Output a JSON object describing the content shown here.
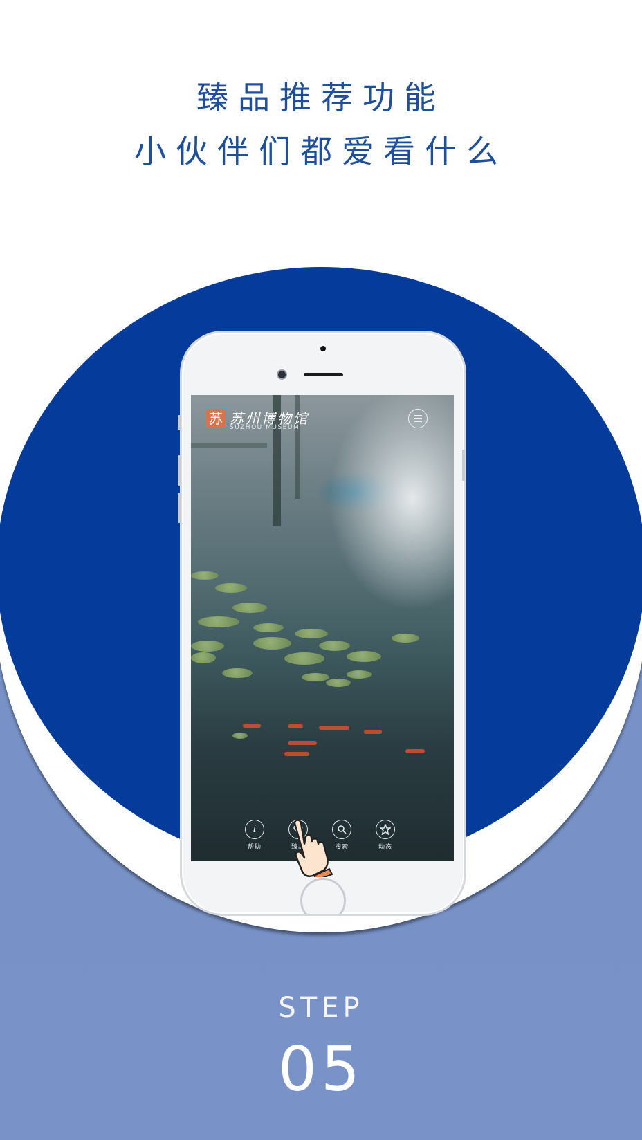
{
  "headline": {
    "line1": "臻品推荐功能",
    "line2": "小伙伴们都爱看什么"
  },
  "app": {
    "logo_mark": "苏",
    "logo_cn": "苏州博物馆",
    "logo_en": "SUZHOU MUSEUM",
    "menu_icon": "list-icon",
    "tabs": [
      {
        "label": "帮助",
        "glyph": "i",
        "icon": "info-icon"
      },
      {
        "label": "臻品",
        "glyph": "",
        "icon": "heart-icon"
      },
      {
        "label": "搜索",
        "glyph": "",
        "icon": "search-icon"
      },
      {
        "label": "动态",
        "glyph": "",
        "icon": "star-icon"
      }
    ]
  },
  "step": {
    "label": "STEP",
    "number": "05"
  },
  "colors": {
    "headline": "#1f4f9c",
    "circle": "#053c9c",
    "panel": "#7690c6",
    "logo": "#d8744b"
  }
}
